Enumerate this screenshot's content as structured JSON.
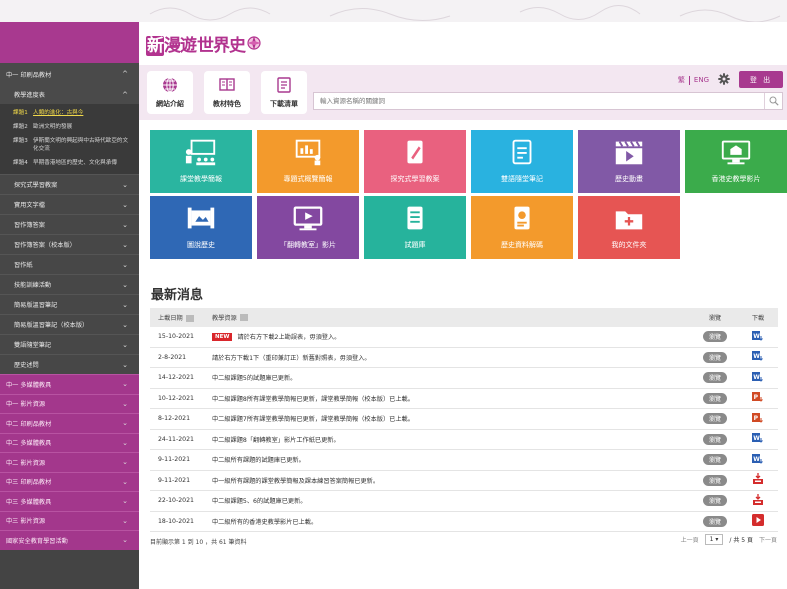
{
  "logo": {
    "first": "新",
    "rest": "漫遊",
    "rest2": "世界史"
  },
  "sidebar": {
    "groups": [
      {
        "label": "中一 印刷品教材",
        "kind": "top",
        "chev": "^"
      },
      {
        "label": "教學進度表",
        "kind": "sub",
        "chev": "^"
      }
    ],
    "lessons": [
      {
        "num": "課題1",
        "text": "人類的進化：古與今",
        "active": true
      },
      {
        "num": "課題2",
        "text": "歐洲文明的發展",
        "active": false
      },
      {
        "num": "課題3",
        "text": "伊斯蘭文明的興起與中古時代歐亞的文化交流",
        "active": false
      },
      {
        "num": "課題4",
        "text": "早期香港地區的歷史、文化與承傳",
        "active": false
      }
    ],
    "items": [
      "探究式學習教案",
      "實用文字檔",
      "習作簿答案",
      "習作簿答案（校本版）",
      "習作紙",
      "技能訓練活動",
      "簡易版溫習筆記",
      "簡易版溫習筆記（校本版）",
      "雙語隨堂筆記",
      "歷史述問"
    ],
    "purple": [
      "中一 多媒體教具",
      "中一 影片資源",
      "中二 印刷品教材",
      "中二 多媒體教具",
      "中二 影片資源",
      "中三 印刷品教材",
      "中三 多媒體教具",
      "中三 影片資源",
      "國家安全教育學習活動"
    ]
  },
  "nav": {
    "buttons": [
      "網站介紹",
      "教材特色",
      "下載清單"
    ],
    "lang_tc": "繁",
    "lang_en": "ENG",
    "logout": "登 出",
    "search_placeholder": "輸入資源名稱的關鍵詞"
  },
  "tiles": [
    {
      "label": "課堂教學簡報",
      "color": "#2ab5a0",
      "icon": "teacher-icon"
    },
    {
      "label": "專題式概覽簡報",
      "color": "#f39a2c",
      "icon": "chart-board-icon"
    },
    {
      "label": "探究式學習教案",
      "color": "#e9617f",
      "icon": "pencil-doc-icon"
    },
    {
      "label": "雙語隨堂筆記",
      "color": "#29b2e0",
      "icon": "notes-icon"
    },
    {
      "label": "歷史動畫",
      "color": "#8159a6",
      "icon": "clapper-icon"
    },
    {
      "label": "香港史教學影片",
      "color": "#3bab4b",
      "icon": "monitor-building-icon"
    },
    {
      "label": "圖說歷史",
      "color": "#2f68b5",
      "icon": "scroll-icon"
    },
    {
      "label": "「翻轉教室」影片",
      "color": "#8348a0",
      "icon": "play-monitor-icon"
    },
    {
      "label": "試題庫",
      "color": "#26b39c",
      "icon": "test-doc-icon"
    },
    {
      "label": "歷史資料解碼",
      "color": "#f39a2c",
      "icon": "decode-doc-icon"
    },
    {
      "label": "我的文件夾",
      "color": "#e65553",
      "icon": "folder-plus-icon"
    }
  ],
  "news": {
    "title": "最新消息",
    "headers": {
      "date": "上載日期",
      "title": "教學資源",
      "view": "瀏覽",
      "dl": "下載"
    },
    "rows": [
      {
        "date": "15-10-2021",
        "new": "NEW",
        "title": "請於右方下載2上勘誤表，毋須登入。",
        "view": "瀏覽",
        "dl": "word"
      },
      {
        "date": "2-8-2021",
        "new": "",
        "title": "請於右方下載1下（重印兼訂正）新舊對照表，毋須登入。",
        "view": "瀏覽",
        "dl": "word"
      },
      {
        "date": "14-12-2021",
        "new": "",
        "title": "中二級課題5的試題庫已更新。",
        "view": "瀏覽",
        "dl": "word"
      },
      {
        "date": "10-12-2021",
        "new": "",
        "title": "中二級課題8所有課堂教學簡報已更新，課堂教學簡報（校本版）已上載。",
        "view": "瀏覽",
        "dl": "ppt"
      },
      {
        "date": "8-12-2021",
        "new": "",
        "title": "中二級課題7所有課堂教學簡報已更新，課堂教學簡報（校本版）已上載。",
        "view": "瀏覽",
        "dl": "ppt"
      },
      {
        "date": "24-11-2021",
        "new": "",
        "title": "中二級課題8「翻轉教室」影片工作紙已更新。",
        "view": "瀏覽",
        "dl": "word"
      },
      {
        "date": "9-11-2021",
        "new": "",
        "title": "中二級所有課題的試題庫已更新。",
        "view": "瀏覽",
        "dl": "word"
      },
      {
        "date": "9-11-2021",
        "new": "",
        "title": "中一級所有課題的課堂教學簡報及課本練習答案簡報已更新。",
        "view": "瀏覽",
        "dl": "pdf"
      },
      {
        "date": "22-10-2021",
        "new": "",
        "title": "中二級課題5、6的試題庫已更新。",
        "view": "瀏覽",
        "dl": "pdf"
      },
      {
        "date": "18-10-2021",
        "new": "",
        "title": "中二級所有的香港史教學影片已上載。",
        "view": "瀏覽",
        "dl": "video"
      }
    ],
    "count": "目前顯示第 1 到 10 ，共 61 筆資料",
    "prev": "上一頁",
    "page": "1",
    "total": "/ 共 5 頁",
    "next": "下一頁"
  }
}
